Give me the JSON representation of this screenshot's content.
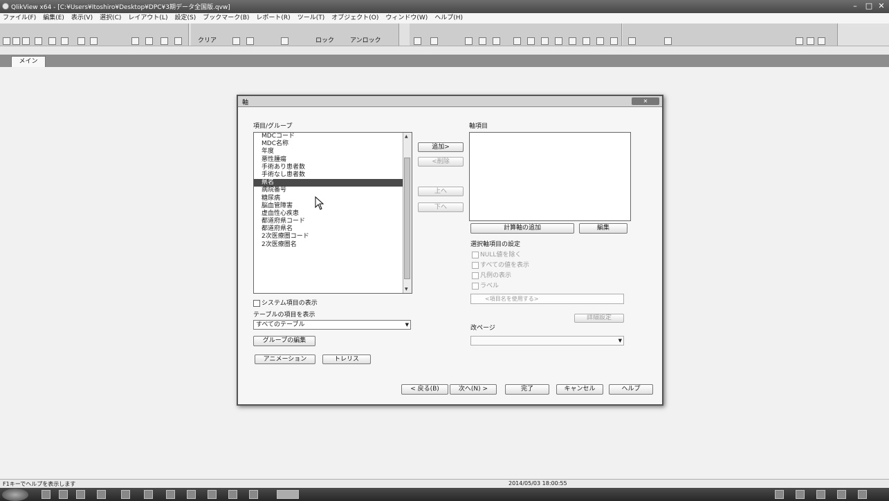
{
  "window": {
    "title": "QlikView x64 - [C:¥Users¥Itoshiro¥Desktop¥DPC¥3期データ全国版.qvw]",
    "minimize": "–",
    "maximize": "□",
    "close": "✕"
  },
  "menu": [
    "ファイル(F)",
    "編集(E)",
    "表示(V)",
    "選択(C)",
    "レイアウト(L)",
    "設定(S)",
    "ブックマーク(B)",
    "レポート(R)",
    "ツール(T)",
    "オブジェクト(O)",
    "ウィンドウ(W)",
    "ヘルプ(H)"
  ],
  "toolbar": {
    "clear": "クリア",
    "lock": "ロック",
    "unlock": "アンロック"
  },
  "tabs": [
    "メイン"
  ],
  "dialog": {
    "title": "軸",
    "close_label": "✕",
    "fields_label": "項目/グループ",
    "fields": [
      "MDCコード",
      "MDC名称",
      "年度",
      "悪性腫瘍",
      "手術あり患者数",
      "手術なし患者数",
      "県名",
      "病院番号",
      "糖尿病",
      "脳血管障害",
      "虚血性心疾患",
      "都道府県コード",
      "都道府県名",
      "2次医療圏コード",
      "2次医療圏名"
    ],
    "selected_index": 6,
    "add_button": "追加>",
    "remove_button": "<削除",
    "up_button": "上へ",
    "down_button": "下へ",
    "dims_label": "軸項目",
    "add_calc_dim_button": "計算軸の追加",
    "edit_button": "編集",
    "dim_settings_label": "選択軸項目の設定",
    "suppress_null": "NULL値を除く",
    "show_all_values": "すべての値を表示",
    "show_legend": "凡例の表示",
    "label_checkbox": "ラベル",
    "label_placeholder": "<項目名を使用する>",
    "advanced_button": "詳細設定",
    "page_break_label": "改ページ",
    "page_break_value": "",
    "show_system_fields": "システム項目の表示",
    "table_fields_label": "テーブルの項目を表示",
    "table_select_value": "すべてのテーブル",
    "edit_groups_button": "グループの編集",
    "animation_button": "アニメーション",
    "trellis_button": "トレリス",
    "back_button": "< 戻る(B)",
    "next_button": "次へ(N) >",
    "finish_button": "完了",
    "cancel_button": "キャンセル",
    "help_button": "ヘルプ"
  },
  "statusbar": {
    "help_text": "F1キーでヘルプを表示します",
    "timestamp": "2014/05/03 18:00:55"
  }
}
